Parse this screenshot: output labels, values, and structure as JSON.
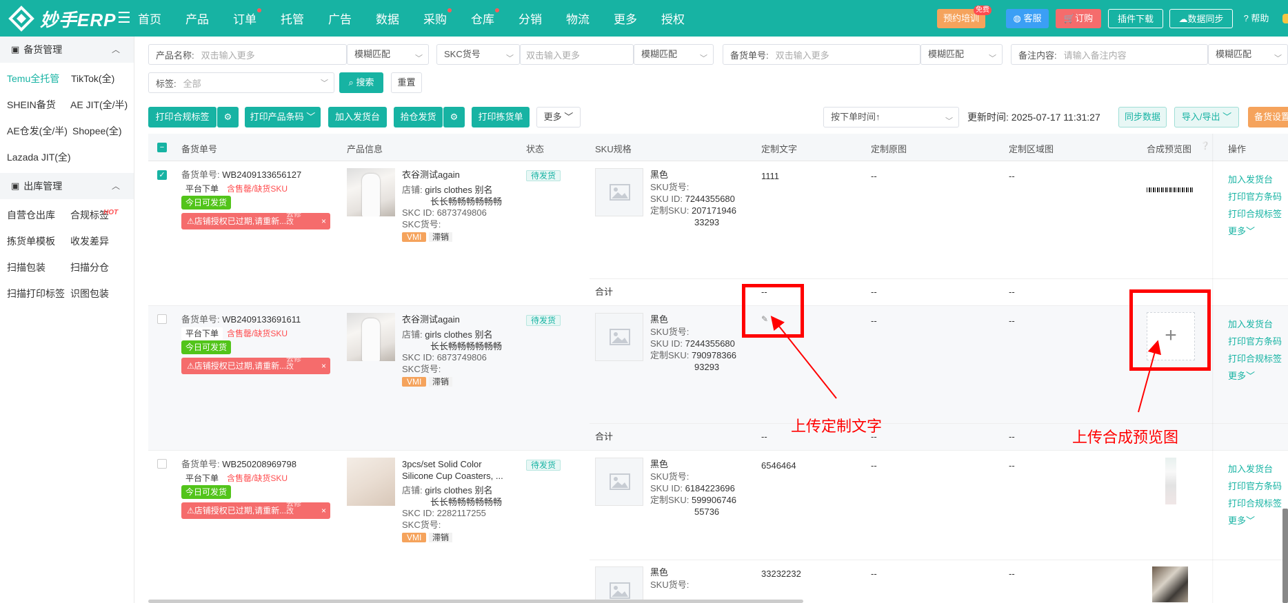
{
  "brand": {
    "name": "妙手ERP"
  },
  "nav": {
    "items": [
      "首页",
      "产品",
      "订单",
      "托管",
      "广告",
      "数据",
      "采购",
      "仓库",
      "分销",
      "物流",
      "更多",
      "授权"
    ]
  },
  "topbar": {
    "training": "预约培训",
    "free": "免费",
    "service": "客服",
    "order": "订购",
    "plugin": "插件下载",
    "sync": "数据同步",
    "help": "帮助"
  },
  "sidebar": {
    "section1": "备货管理",
    "group1": [
      "Temu全托管",
      "TikTok(全)",
      "SHEIN备货",
      "AE JIT(全/半)",
      "AE仓发(全/半)",
      "Shopee(全)",
      "Lazada JIT(全)"
    ],
    "section2": "出库管理",
    "group2": [
      "自营仓出库",
      "合规标签",
      "拣货单模板",
      "收发差异",
      "扫描包装",
      "扫描分仓",
      "扫描打印标签",
      "识图包装"
    ],
    "hot": "HOT"
  },
  "filters": {
    "product_name_label": "产品名称:",
    "product_name_ph": "双击输入更多",
    "match1": "模糊匹配",
    "skc_select": "SKC货号",
    "skc_ph": "双击输入更多",
    "match2": "模糊匹配",
    "stock_no_label": "备货单号:",
    "stock_no_ph": "双击输入更多",
    "match3": "模糊匹配",
    "remark_label": "备注内容:",
    "remark_ph": "请输入备注内容",
    "match4": "模糊匹配",
    "tag_label": "标签:",
    "tag_value": "全部",
    "search": "搜索",
    "reset": "重置"
  },
  "toolbar": {
    "print_compliance": "打印合规标签",
    "print_barcode": "打印产品条码",
    "add_ship": "加入发货台",
    "pickup_ship": "拾仓发货",
    "print_pick": "打印拣货单",
    "more": "更多",
    "sort": "按下单时间↑",
    "update_label": "更新时间:",
    "update_time": "2025-07-17 11:31:27",
    "sync": "同步数据",
    "import_export": "导入/导出",
    "settings": "备货设置"
  },
  "table": {
    "headers": [
      "备货单号",
      "产品信息",
      "状态",
      "SKU规格",
      "定制文字",
      "定制原图",
      "定制区域图",
      "合成预览图",
      "操作"
    ],
    "rows": [
      {
        "no_label": "备货单号:",
        "no": "WB2409133656127",
        "platform": "平台下单",
        "sensitive": "含售罄/缺货SKU",
        "ship_today": "今日可发货",
        "warn": "⚠店铺授权已过期,请重新...",
        "jump": "去修改",
        "title": "衣谷测试again",
        "shop_label": "店铺:",
        "shop1": "girls clothes 别名",
        "shop2": "长长畅畅畅畅畅畅",
        "skc_id": "SKC ID:  6873749806",
        "skc_no": "SKC货号:",
        "vmi": "VMI",
        "slow": "滞销",
        "status": "待发货",
        "color": "黑色",
        "sku_no": "SKU货号:",
        "sku_id_label": "SKU ID:",
        "sku_id": "7244355680",
        "custom_sku_label": "定制SKU:",
        "custom_sku1": "207171946",
        "custom_sku2": "33293",
        "custom_text": "1111",
        "orig": "--",
        "area": "--",
        "total": "合计",
        "total_text": "--",
        "total_orig": "--",
        "total_area": "--"
      },
      {
        "no_label": "备货单号:",
        "no": "WB2409133691611",
        "platform": "平台下单",
        "sensitive": "含售罄/缺货SKU",
        "ship_today": "今日可发货",
        "warn": "⚠店铺授权已过期,请重新...",
        "jump": "去修改",
        "title": "衣谷测试again",
        "shop_label": "店铺:",
        "shop1": "girls clothes 别名",
        "shop2": "长长畅畅畅畅畅畅",
        "skc_id": "SKC ID:  6873749806",
        "skc_no": "SKC货号:",
        "vmi": "VMI",
        "slow": "滞销",
        "status": "待发货",
        "color": "黑色",
        "sku_no": "SKU货号:",
        "sku_id_label": "SKU ID:",
        "sku_id": "7244355680",
        "custom_sku_label": "定制SKU:",
        "custom_sku1": "790978366",
        "custom_sku2": "93293",
        "orig": "--",
        "area": "--",
        "total": "合计",
        "total_text": "--",
        "total_orig": "--",
        "total_area": "--"
      },
      {
        "no_label": "备货单号:",
        "no": "WB250208969798",
        "platform": "平台下单",
        "sensitive": "含售罄/缺货SKU",
        "ship_today": "今日可发货",
        "warn": "⚠店铺授权已过期,请重新...",
        "jump": "去修改",
        "title1": "3pcs/set Solid Color",
        "title2": "Silicone Cup Coasters, ...",
        "shop_label": "店铺:",
        "shop1": "girls clothes 别名",
        "shop2": "长长畅畅畅畅畅畅",
        "skc_id": "SKC ID:  2282117255",
        "skc_no": "SKC货号:",
        "vmi": "VMI",
        "slow": "滞销",
        "status": "待发货",
        "color": "黑色",
        "sku_no": "SKU货号:",
        "sku_id_label": "SKU ID:",
        "sku_id": "6184223696",
        "custom_sku_label": "定制SKU:",
        "custom_sku1": "599906746",
        "custom_sku2": "55736",
        "custom_text": "6546464",
        "orig": "--",
        "area": "--",
        "color2": "黑色",
        "sku_no2": "SKU货号:",
        "custom_text2": "33232232",
        "orig2": "--",
        "area2": "--"
      }
    ],
    "actions": {
      "add": "加入发货台",
      "print_official": "打印官方条码",
      "print_compliance": "打印合规标签",
      "more": "更多"
    }
  },
  "annotations": {
    "custom_text": "上传定制文字",
    "preview": "上传合成预览图"
  },
  "colors": {
    "brand": "#17b3a3",
    "alert": "#ff0000"
  }
}
